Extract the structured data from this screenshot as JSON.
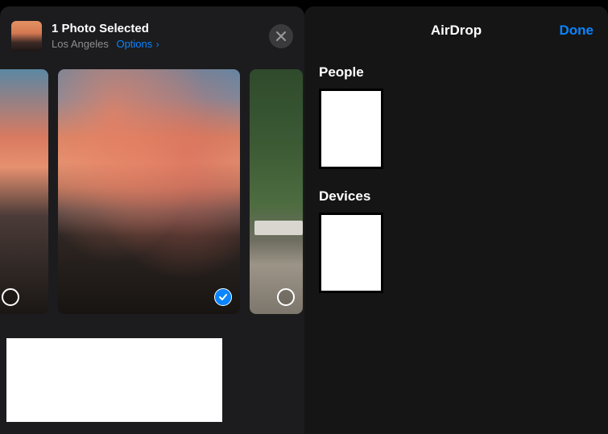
{
  "share": {
    "title": "1 Photo Selected",
    "location": "Los Angeles",
    "options_label": "Options",
    "bottom_placeholder": ""
  },
  "photos": [
    {
      "selected": false
    },
    {
      "selected": true
    },
    {
      "selected": false
    }
  ],
  "airdrop": {
    "title": "AirDrop",
    "done_label": "Done",
    "sections": {
      "people": {
        "label": "People",
        "items": [
          ""
        ]
      },
      "devices": {
        "label": "Devices",
        "items": [
          ""
        ]
      }
    }
  }
}
